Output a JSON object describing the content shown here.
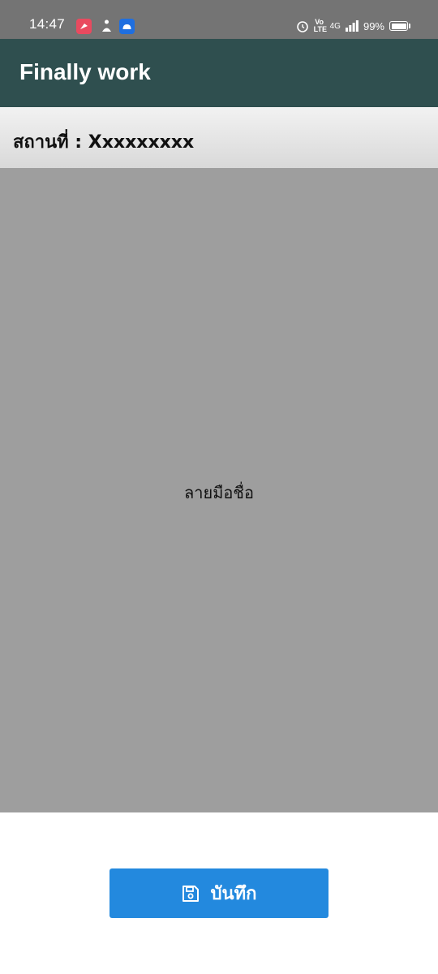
{
  "status_bar": {
    "time": "14:47",
    "network": "4G",
    "battery": "99%",
    "volte": "Vo LTE"
  },
  "app_bar": {
    "title": "Finally work"
  },
  "location": {
    "text": "สถานที่ : Xxxxxxxxx"
  },
  "signature": {
    "label": "ลายมือชื่อ"
  },
  "actions": {
    "save_label": "บันทึก",
    "save_icon": "floppy-disk-icon",
    "save_color": "#2389de"
  },
  "colors": {
    "app_bar": "#2f4f4f",
    "signature_area": "#9e9e9e"
  }
}
